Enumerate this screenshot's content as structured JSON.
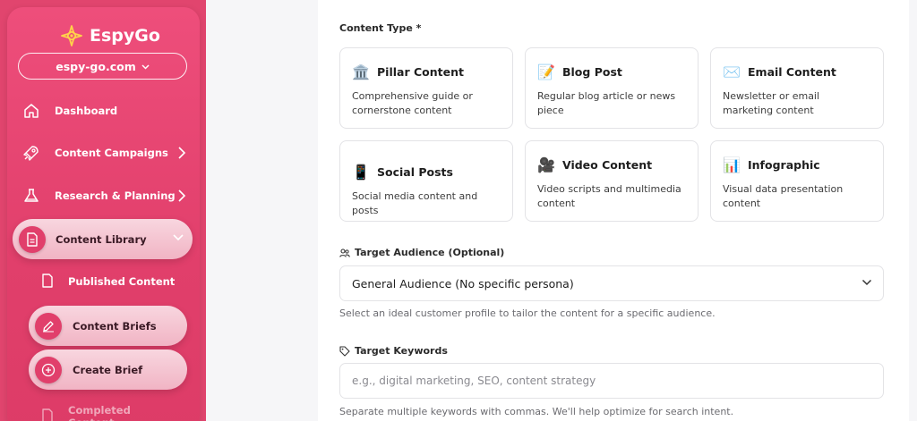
{
  "app": {
    "name": "EspyGo",
    "domain": "espy-go.com",
    "brand_color": "#e13f6b"
  },
  "sidebar": {
    "items": [
      {
        "label": "Dashboard",
        "icon": "home-icon"
      },
      {
        "label": "Content Campaigns",
        "icon": "rocket-icon"
      },
      {
        "label": "Research & Planning",
        "icon": "flask-icon"
      },
      {
        "label": "Content Library",
        "icon": "document-icon",
        "expanded": true
      }
    ],
    "subitems": [
      {
        "label": "Published Content",
        "icon": "file-icon"
      },
      {
        "label": "Content Briefs",
        "icon": "pencil-icon"
      },
      {
        "label": "Create Brief",
        "icon": "plus-circle-icon"
      },
      {
        "label": "Completed Content",
        "icon": "file-icon"
      }
    ]
  },
  "form": {
    "content_type_label": "Content Type *",
    "content_types": [
      {
        "title": "Pillar Content",
        "emoji": "🏛️",
        "desc": "Comprehensive guide or cornerstone content"
      },
      {
        "title": "Blog Post",
        "emoji": "📝",
        "desc": "Regular blog article or news piece"
      },
      {
        "title": "Email Content",
        "emoji": "✉️",
        "desc": "Newsletter or email marketing content"
      },
      {
        "title": "Social Posts",
        "emoji": "📱",
        "desc": "Social media content and posts"
      },
      {
        "title": "Video Content",
        "emoji": "🎥",
        "desc": "Video scripts and multimedia content"
      },
      {
        "title": "Infographic",
        "emoji": "📊",
        "desc": "Visual data presentation content"
      }
    ],
    "audience_label": "Target Audience (Optional)",
    "audience_value": "General Audience (No specific persona)",
    "audience_help": "Select an ideal customer profile to tailor the content for a specific audience.",
    "keywords_label": "Target Keywords",
    "keywords_placeholder": "e.g., digital marketing, SEO, content strategy",
    "keywords_help": "Separate multiple keywords with commas. We'll help optimize for search intent."
  }
}
